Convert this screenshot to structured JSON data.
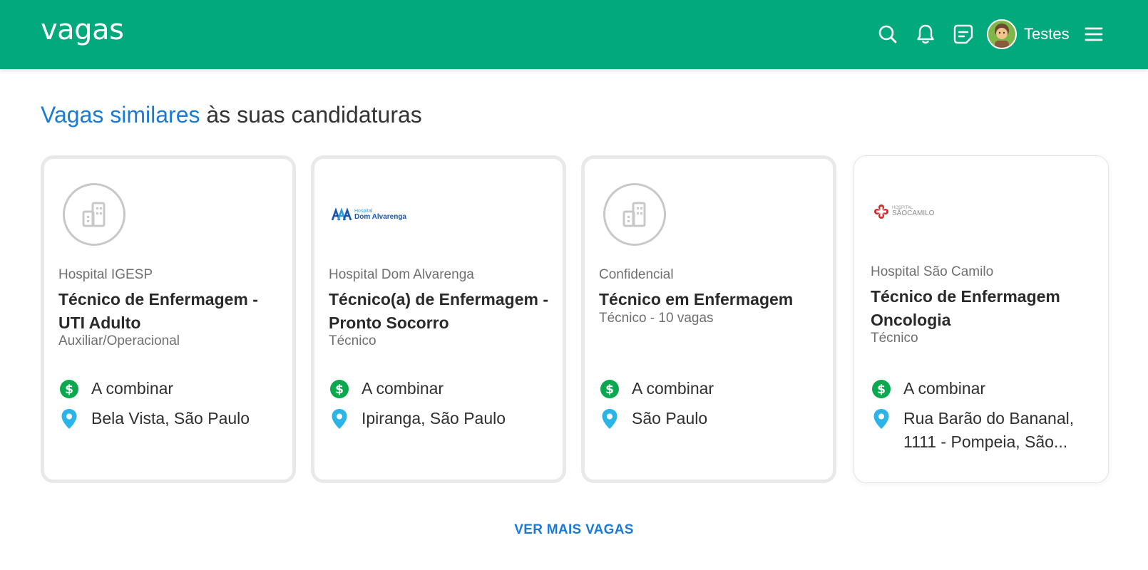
{
  "header": {
    "logo": "vagas",
    "user_name": "Testes",
    "icons": [
      "search-icon",
      "bell-icon",
      "message-icon",
      "avatar",
      "menu-icon"
    ],
    "background_color": "#02a97c"
  },
  "section": {
    "title_highlight": "Vagas similares",
    "title_rest": " às suas candidaturas",
    "accent_color": "#1b7ad4"
  },
  "cards": [
    {
      "logo": "building-placeholder-icon",
      "company": "Hospital IGESP",
      "title": "Técnico de Enfermagem - UTI Adulto",
      "level": "Auxiliar/Operacional",
      "salary": "A combinar",
      "location": "Bela Vista, São Paulo"
    },
    {
      "logo": "hospital-dom-alvarenga-logo",
      "logo_text_small": "Hospital",
      "logo_text": "Dom Alvarenga",
      "company": "Hospital Dom Alvarenga",
      "title": "Técnico(a) de Enfermagem - Pronto Socorro",
      "level": "Técnico",
      "salary": "A combinar",
      "location": "Ipiranga, São Paulo"
    },
    {
      "logo": "building-placeholder-icon",
      "company": "Confidencial",
      "title": "Técnico em Enfermagem",
      "level": "Técnico - 10 vagas",
      "salary": "A combinar",
      "location": "São Paulo"
    },
    {
      "logo": "hospital-sao-camilo-logo",
      "logo_text_small": "HOSPITAL",
      "logo_text": "SÃOCAMILO",
      "company": "Hospital São Camilo",
      "title": "Técnico de Enfermagem Oncologia",
      "level": "Técnico",
      "salary": "A combinar",
      "location": "Rua Barão do Bananal, 1111 - Pompeia, São..."
    }
  ],
  "more_button": "VER MAIS VAGAS",
  "colors": {
    "salary_icon": "#0aa84f",
    "location_icon": "#2bb4e8"
  }
}
